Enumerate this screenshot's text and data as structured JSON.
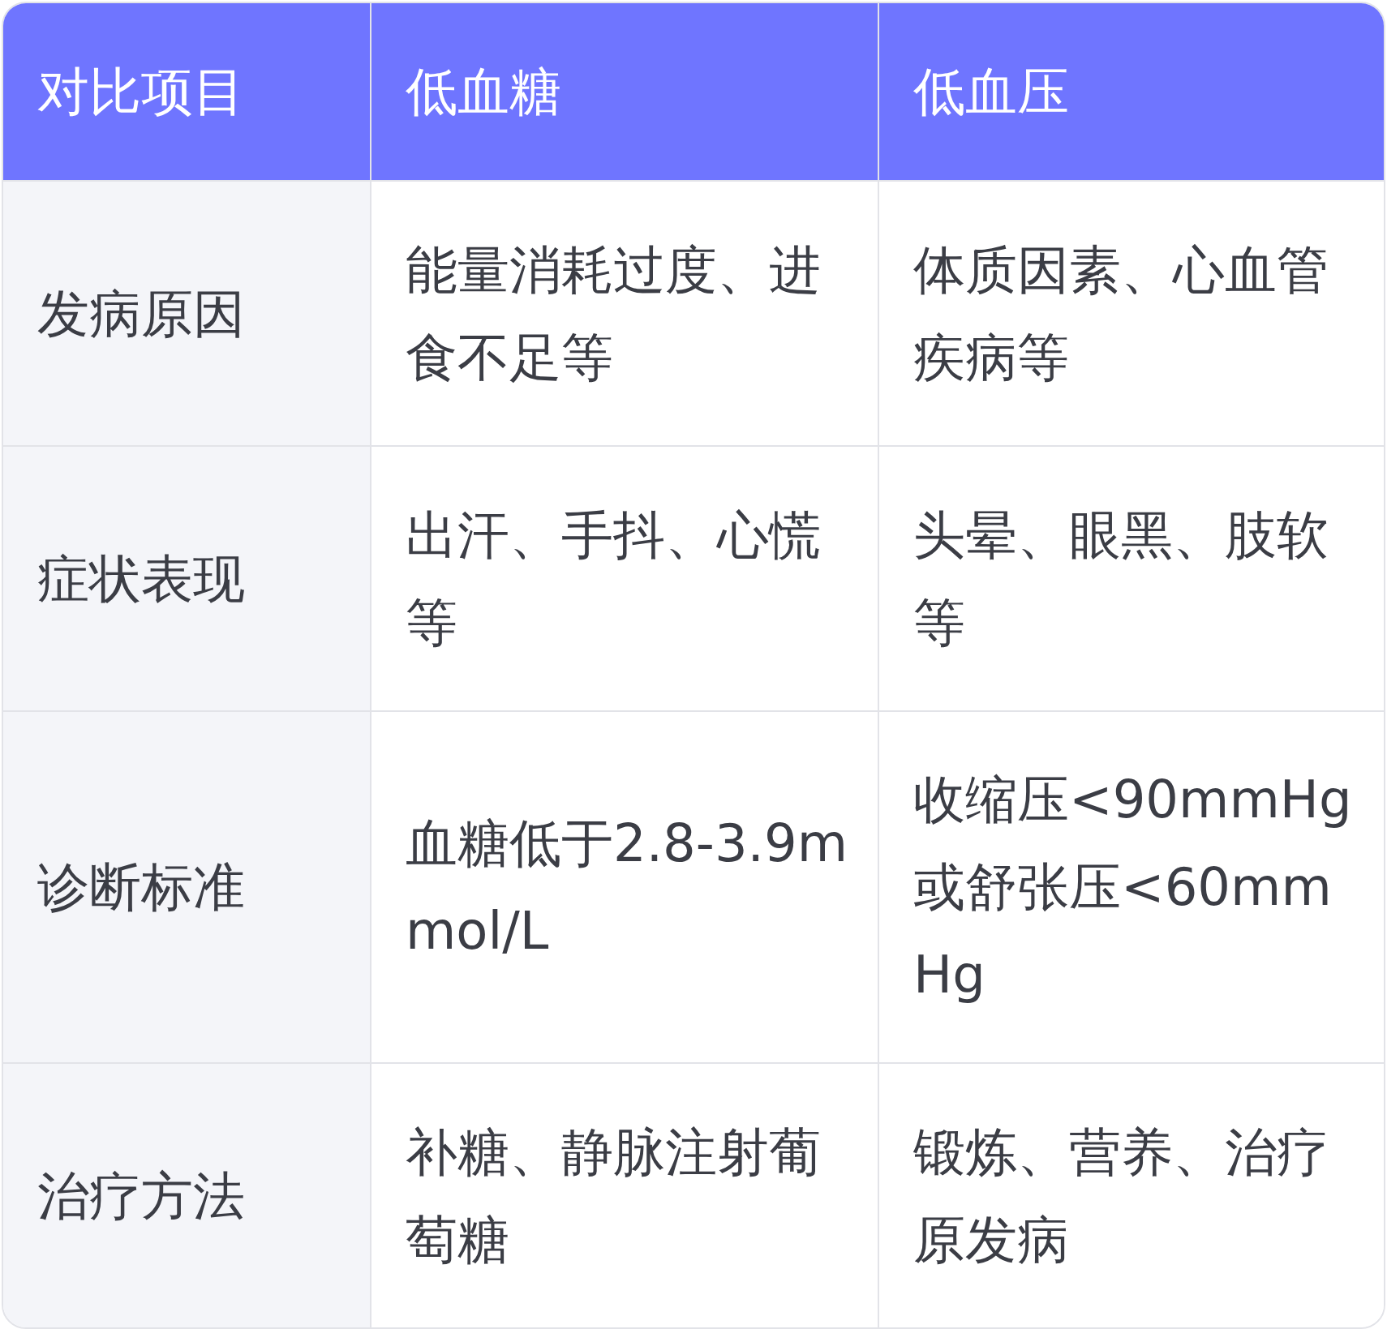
{
  "table": {
    "columns": [
      "对比项目",
      "低血糖",
      "低血压"
    ],
    "rows": [
      {
        "cells": [
          "发病原因",
          "能量消耗过度、进食不足等",
          "体质因素、心血管疾病等"
        ]
      },
      {
        "cells": [
          "症状表现",
          "出汗、手抖、心慌等",
          "头晕、眼黑、肢软等"
        ]
      },
      {
        "cells": [
          "诊断标准",
          "血糖低于2.8-3.9mmol/L",
          "收缩压<90mmHg或舒张压<60mmHg"
        ]
      },
      {
        "cells": [
          "治疗方法",
          "补糖、静脉注射葡萄糖",
          "锻炼、营养、治疗原发病"
        ]
      }
    ]
  }
}
